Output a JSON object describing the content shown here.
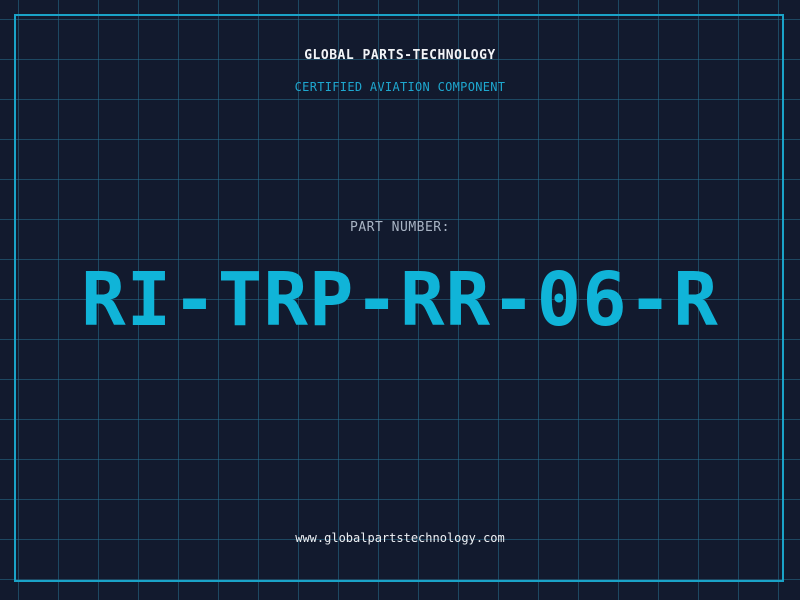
{
  "label": {
    "company": "GLOBAL PARTS-TECHNOLOGY",
    "subtitle": "CERTIFIED AVIATION COMPONENT",
    "part_label": "PART NUMBER:",
    "part_number": "RI-TRP-RR-06-R",
    "url": "www.globalpartstechnology.com"
  },
  "colors": {
    "background": "#121a2e",
    "grid": "#266e8c",
    "border": "#1aa3c8",
    "accent": "#10b4d8",
    "text_primary": "#f2f4f7",
    "text_secondary": "#a9b4c4"
  }
}
